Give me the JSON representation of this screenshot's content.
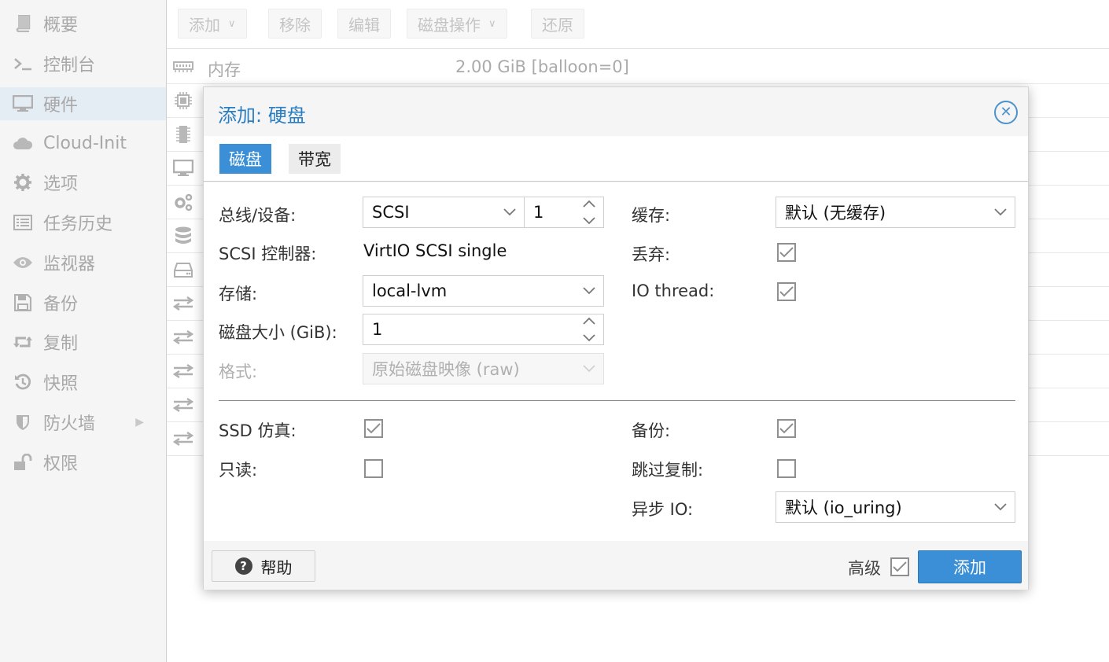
{
  "sidebar": {
    "items": [
      {
        "label": "概要",
        "icon": "book-icon"
      },
      {
        "label": "控制台",
        "icon": "terminal-icon"
      },
      {
        "label": "硬件",
        "icon": "monitor-icon"
      },
      {
        "label": "Cloud-Init",
        "icon": "cloud-icon"
      },
      {
        "label": "选项",
        "icon": "gear-icon"
      },
      {
        "label": "任务历史",
        "icon": "list-icon"
      },
      {
        "label": "监视器",
        "icon": "eye-icon"
      },
      {
        "label": "备份",
        "icon": "floppy-icon"
      },
      {
        "label": "复制",
        "icon": "retweet-icon"
      },
      {
        "label": "快照",
        "icon": "history-icon"
      },
      {
        "label": "防火墙",
        "icon": "shield-icon"
      },
      {
        "label": "权限",
        "icon": "unlock-icon"
      }
    ],
    "active_index": 2
  },
  "toolbar": {
    "add": "添加",
    "remove": "移除",
    "edit": "编辑",
    "disk_action": "磁盘操作",
    "revert": "还原"
  },
  "hardware_list": {
    "rows": [
      {
        "name": "内存",
        "value": "2.00 GiB [balloon=0]"
      }
    ]
  },
  "dialog": {
    "title": "添加: 硬盘",
    "tabs": [
      "磁盘",
      "带宽"
    ],
    "active_tab": 0,
    "bus_device": {
      "label": "总线/设备:",
      "bus": "SCSI",
      "device": "1"
    },
    "scsi_controller": {
      "label": "SCSI 控制器:",
      "value": "VirtIO SCSI single"
    },
    "storage": {
      "label": "存储:",
      "value": "local-lvm"
    },
    "disk_size": {
      "label": "磁盘大小 (GiB):",
      "value": "1"
    },
    "format": {
      "label": "格式:",
      "value": "原始磁盘映像 (raw)"
    },
    "cache": {
      "label": "缓存:",
      "value": "默认 (无缓存)"
    },
    "discard": {
      "label": "丢弃:",
      "checked": true
    },
    "io_thread": {
      "label": "IO thread:",
      "checked": true
    },
    "ssd_emulation": {
      "label": "SSD 仿真:",
      "checked": true
    },
    "read_only": {
      "label": "只读:",
      "checked": false
    },
    "backup": {
      "label": "备份:",
      "checked": true
    },
    "skip_replication": {
      "label": "跳过复制:",
      "checked": false
    },
    "async_io": {
      "label": "异步 IO:",
      "value": "默认 (io_uring)"
    },
    "footer": {
      "help": "帮助",
      "advanced": "高级",
      "advanced_checked": true,
      "add": "添加"
    }
  }
}
